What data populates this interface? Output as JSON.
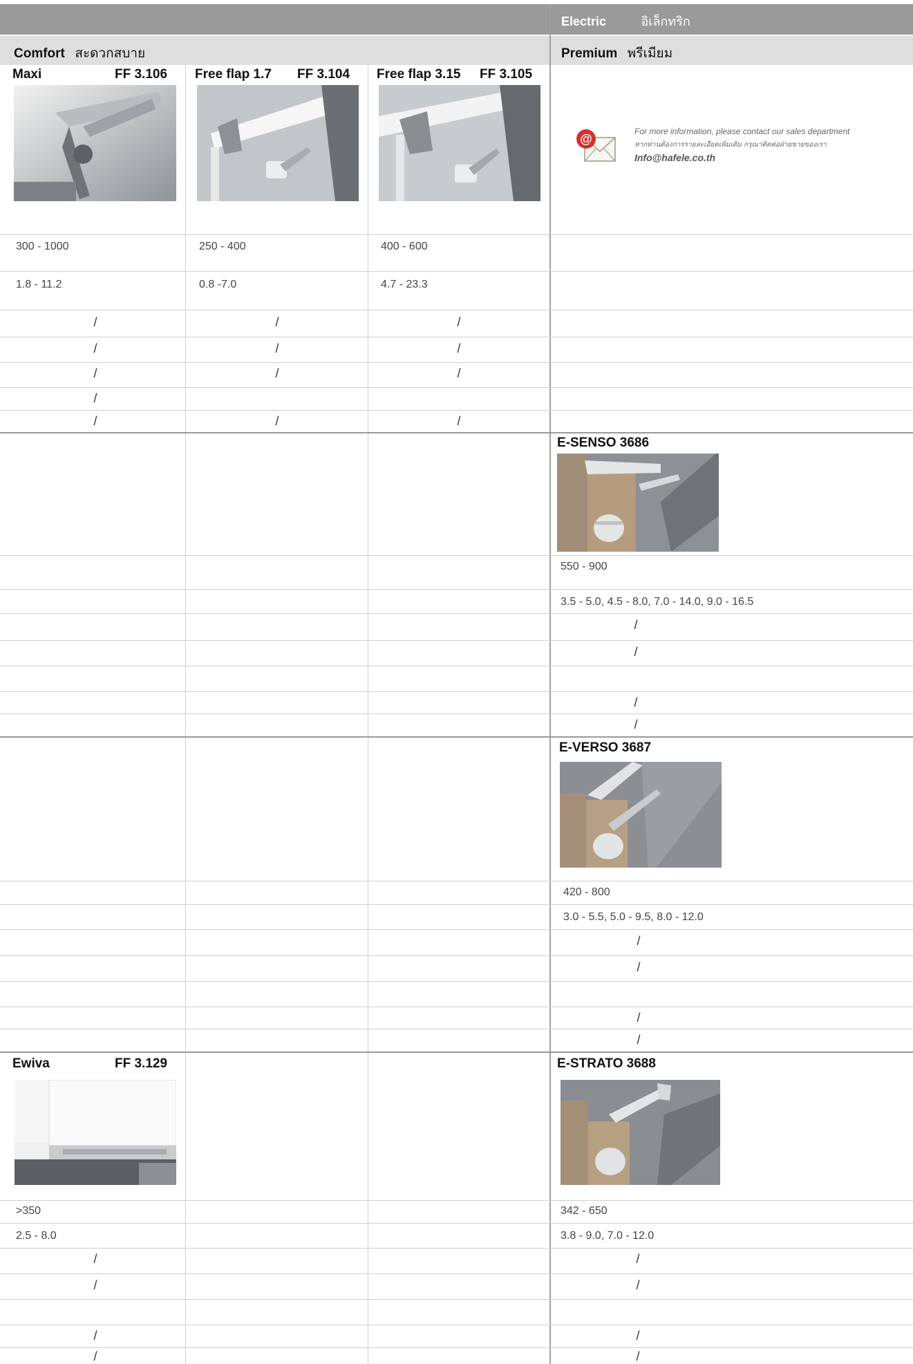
{
  "header": {
    "electric_en": "Electric",
    "electric_th": "อิเล็กทริก",
    "comfort_en": "Comfort",
    "comfort_th": "สะดวกสบาย",
    "premium_en": "Premium",
    "premium_th": "พรีเมียม"
  },
  "comfort_products": [
    {
      "name": "Maxi",
      "code": "FF 3.106",
      "range1": "300 - 1000",
      "range2": "1.8 - 11.2"
    },
    {
      "name": "Free flap 1.7",
      "code": "FF 3.104",
      "range1": "250 - 400",
      "range2": "0.8 -7.0"
    },
    {
      "name": "Free flap 3.15",
      "code": "FF 3.105",
      "range1": "400 - 600",
      "range2": "4.7 - 23.3"
    },
    {
      "name": "Ewiva",
      "code": "FF 3.129",
      "range1": ">350",
      "range2": "2.5 - 8.0"
    }
  ],
  "contact": {
    "line1": "For more information, please contact our sales department",
    "line2": "หากท่านต้องการรายละเอียดเพิ่มเติม กรุณาติดต่อฝ่ายขายของเรา",
    "email": "Info@hafele.co.th"
  },
  "electric_products": [
    {
      "name": "E-SENSO 3686",
      "range1": "550 - 900",
      "range2": "3.5 - 5.0, 4.5 - 8.0, 7.0 - 14.0, 9.0 - 16.5"
    },
    {
      "name": "E-VERSO 3687",
      "range1": "420 - 800",
      "range2": "3.0 - 5.5, 5.0 - 9.5, 8.0 - 12.0"
    },
    {
      "name": "E-STRATO 3688",
      "range1": "342 - 650",
      "range2": "3.8 - 9.0, 7.0 - 12.0"
    }
  ],
  "mark": "/",
  "icons": {
    "photo": "product-photo",
    "mail": "mail-icon"
  },
  "colors": {
    "header_dark": "#9a9a9a",
    "header_light": "#dedede",
    "contact_at": "#d2322d"
  }
}
